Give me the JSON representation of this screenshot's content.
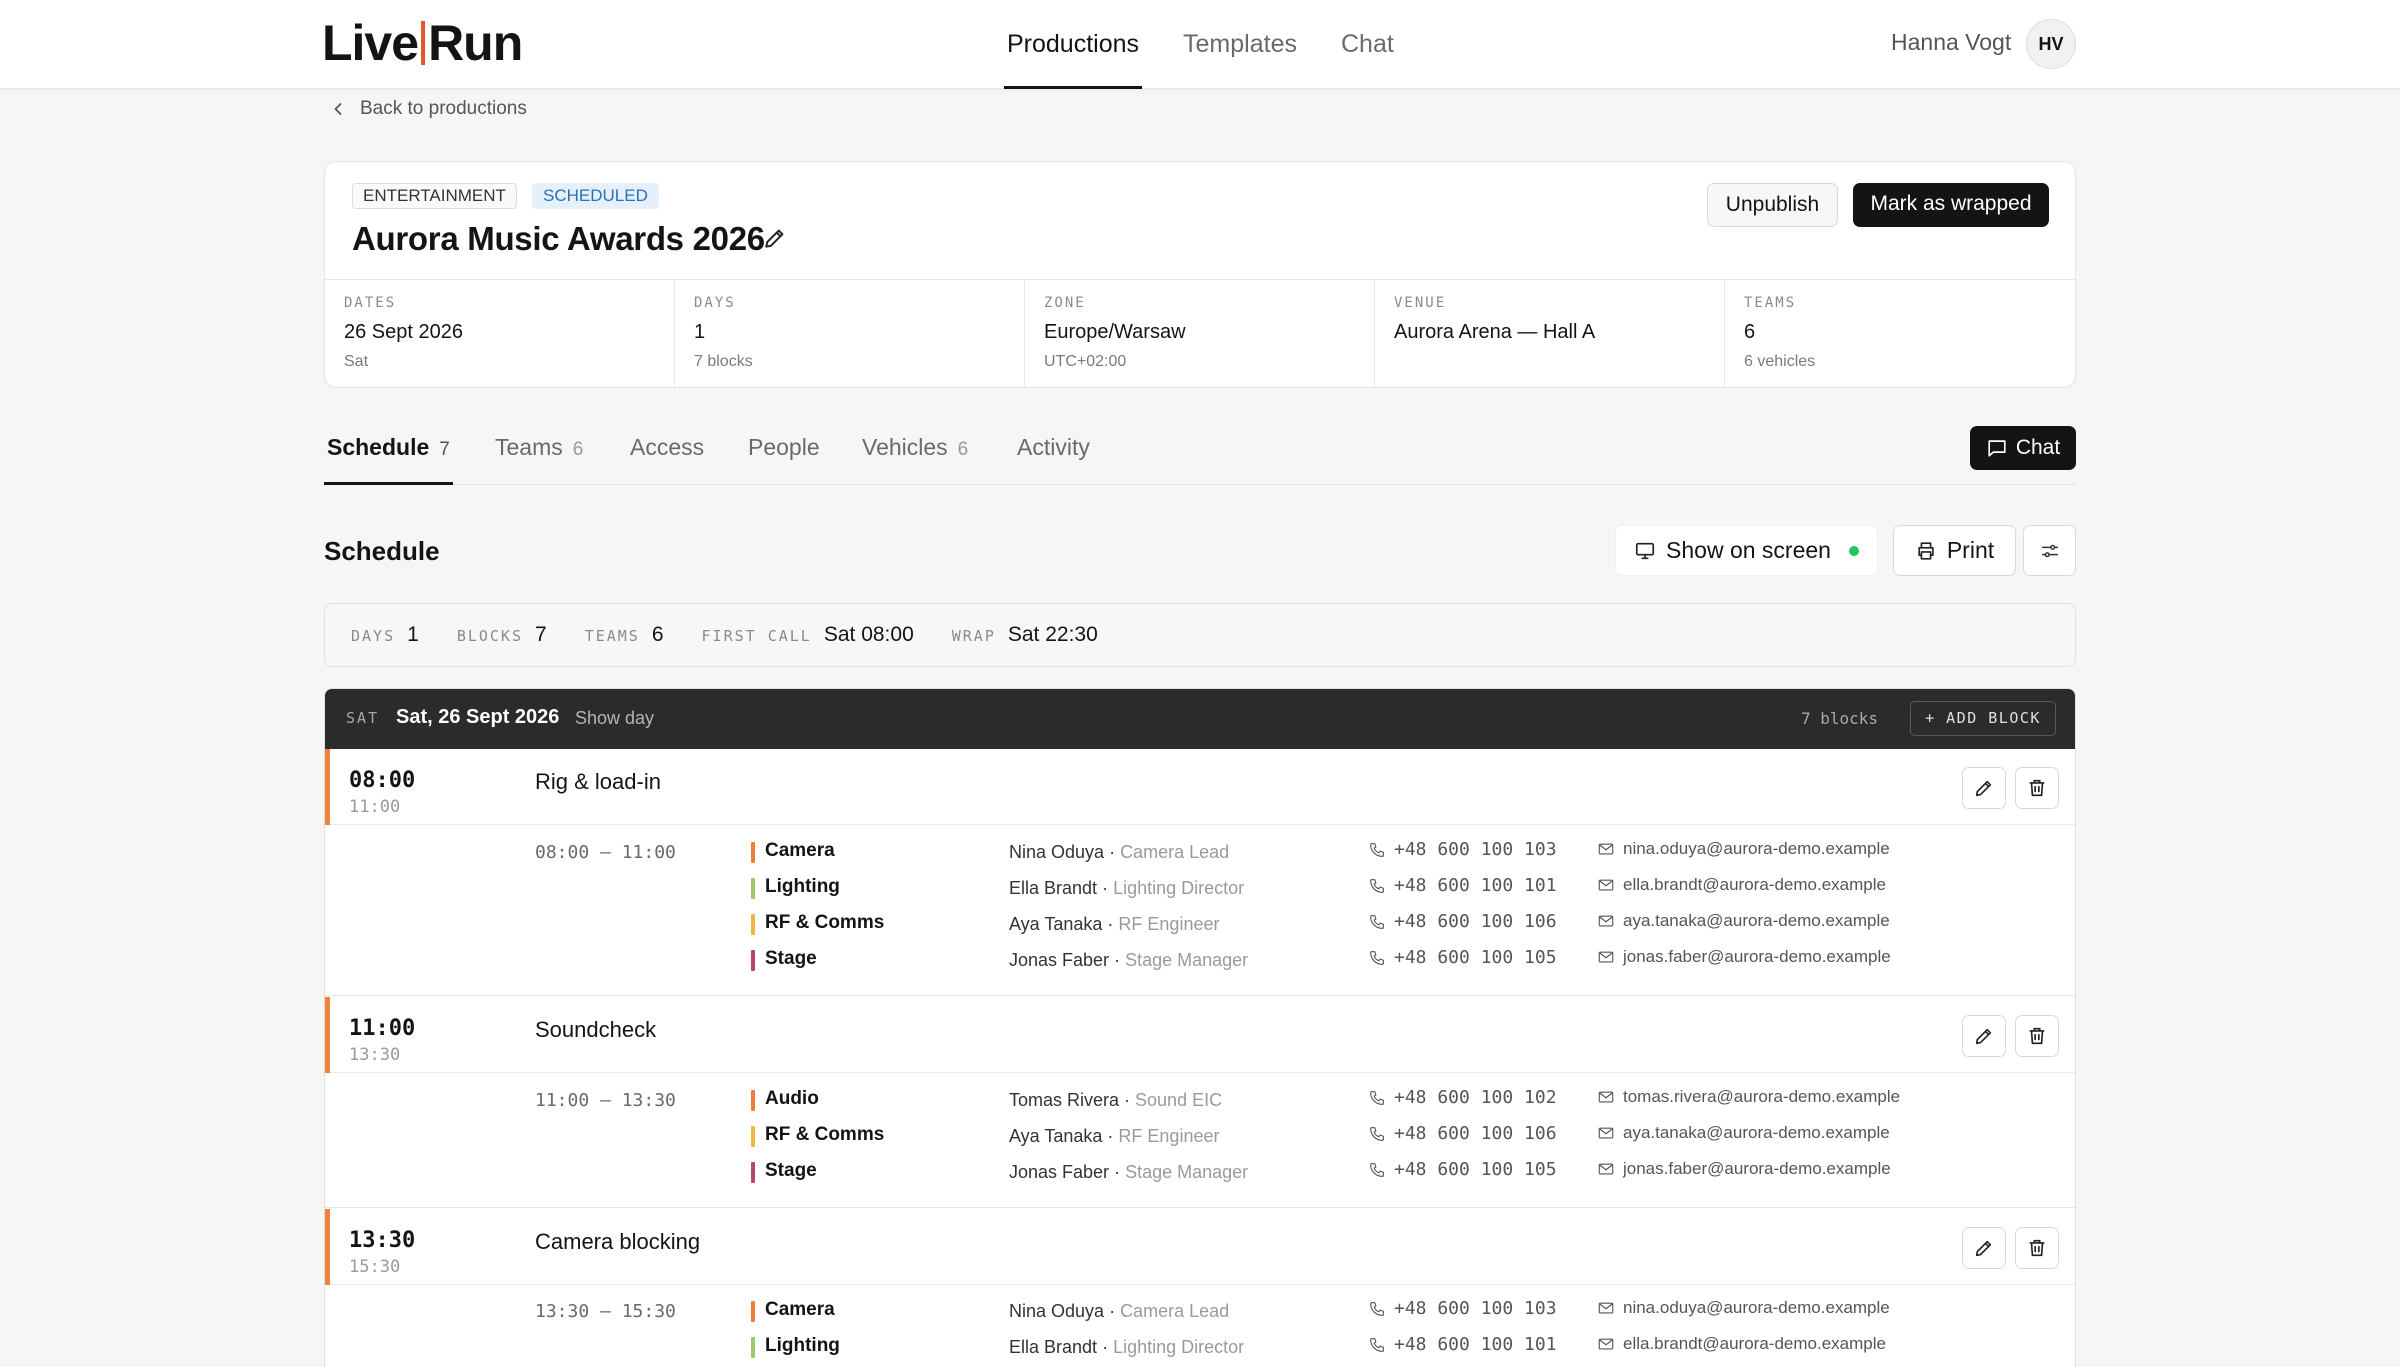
{
  "header": {
    "logo_left": "Live",
    "logo_right": "Run",
    "nav": [
      "Productions",
      "Templates",
      "Chat"
    ],
    "user_name": "Hanna Vogt",
    "user_initials": "HV"
  },
  "back_label": "Back to productions",
  "production": {
    "category": "ENTERTAINMENT",
    "status": "SCHEDULED",
    "title": "Aurora Music Awards 2026",
    "unpublish_label": "Unpublish",
    "wrap_label": "Mark as wrapped",
    "meta": [
      {
        "label": "DATES",
        "value": "26 Sept 2026",
        "sub": "Sat"
      },
      {
        "label": "DAYS",
        "value": "1",
        "sub": "7 blocks"
      },
      {
        "label": "ZONE",
        "value": "Europe/Warsaw",
        "sub": "UTC+02:00"
      },
      {
        "label": "VENUE",
        "value": "Aurora Arena — Hall A",
        "sub": ""
      },
      {
        "label": "TEAMS",
        "value": "6",
        "sub": "6 vehicles"
      }
    ]
  },
  "tabs": [
    {
      "label": "Schedule",
      "count": "7"
    },
    {
      "label": "Teams",
      "count": "6"
    },
    {
      "label": "Access",
      "count": ""
    },
    {
      "label": "People",
      "count": ""
    },
    {
      "label": "Vehicles",
      "count": "6"
    },
    {
      "label": "Activity",
      "count": ""
    }
  ],
  "chat_label": "Chat",
  "schedule": {
    "title": "Schedule",
    "show_on_screen": "Show on screen",
    "print": "Print",
    "stats": [
      {
        "label": "DAYS",
        "value": "1"
      },
      {
        "label": "BLOCKS",
        "value": "7"
      },
      {
        "label": "TEAMS",
        "value": "6"
      },
      {
        "label": "FIRST CALL",
        "value": "Sat 08:00"
      },
      {
        "label": "WRAP",
        "value": "Sat 22:30"
      }
    ],
    "day": {
      "dow": "SAT",
      "date": "Sat, 26 Sept 2026",
      "show_day": "Show day",
      "count": "7 blocks",
      "add_block": "+ ADD BLOCK"
    },
    "blocks": [
      {
        "start": "08:00",
        "end": "11:00",
        "name": "Rig & load-in",
        "rows": [
          {
            "range": "08:00 – 11:00",
            "team": "Camera",
            "person": "Nina Oduya",
            "role": "Camera Lead",
            "phone": "+48 600 100 103",
            "email": "nina.oduya@aurora-demo.example"
          },
          {
            "range": "",
            "team": "Lighting",
            "person": "Ella Brandt",
            "role": "Lighting Director",
            "phone": "+48 600 100 101",
            "email": "ella.brandt@aurora-demo.example"
          },
          {
            "range": "",
            "team": "RF & Comms",
            "person": "Aya Tanaka",
            "role": "RF Engineer",
            "phone": "+48 600 100 106",
            "email": "aya.tanaka@aurora-demo.example"
          },
          {
            "range": "",
            "team": "Stage",
            "person": "Jonas Faber",
            "role": "Stage Manager",
            "phone": "+48 600 100 105",
            "email": "jonas.faber@aurora-demo.example"
          }
        ]
      },
      {
        "start": "11:00",
        "end": "13:30",
        "name": "Soundcheck",
        "rows": [
          {
            "range": "11:00 – 13:30",
            "team": "Audio",
            "person": "Tomas Rivera",
            "role": "Sound EIC",
            "phone": "+48 600 100 102",
            "email": "tomas.rivera@aurora-demo.example"
          },
          {
            "range": "",
            "team": "RF & Comms",
            "person": "Aya Tanaka",
            "role": "RF Engineer",
            "phone": "+48 600 100 106",
            "email": "aya.tanaka@aurora-demo.example"
          },
          {
            "range": "",
            "team": "Stage",
            "person": "Jonas Faber",
            "role": "Stage Manager",
            "phone": "+48 600 100 105",
            "email": "jonas.faber@aurora-demo.example"
          }
        ]
      },
      {
        "start": "13:30",
        "end": "15:30",
        "name": "Camera blocking",
        "rows": [
          {
            "range": "13:30 – 15:30",
            "team": "Camera",
            "person": "Nina Oduya",
            "role": "Camera Lead",
            "phone": "+48 600 100 103",
            "email": "nina.oduya@aurora-demo.example"
          },
          {
            "range": "",
            "team": "Lighting",
            "person": "Ella Brandt",
            "role": "Lighting Director",
            "phone": "+48 600 100 101",
            "email": "ella.brandt@aurora-demo.example"
          }
        ]
      }
    ]
  },
  "team_colors": {
    "Camera": "#ef7d3a",
    "Lighting": "#9acb6a",
    "RF & Comms": "#f2b640",
    "Stage": "#b8456b",
    "Audio": "#ef7d3a"
  },
  "icons": {
    "back": "chevron-left-icon",
    "edit": "pencil-icon",
    "delete": "trash-icon",
    "phone": "phone-icon",
    "email": "mail-icon",
    "monitor": "monitor-icon",
    "print": "printer-icon",
    "filter": "sliders-icon",
    "chat": "message-icon"
  },
  "accent_color": "#f0823c",
  "live_color": "#23c55e"
}
